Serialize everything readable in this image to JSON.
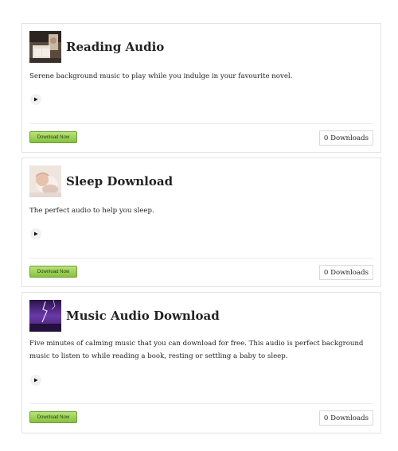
{
  "downloads": [
    {
      "title": "Reading Audio",
      "description": "Serene background music to play while you indulge in your favourite novel.",
      "button_label": "Download Now",
      "count_label": "0 Downloads",
      "thumbnail": "reading-photo-thumbnail"
    },
    {
      "title": "Sleep Download",
      "description": "The perfect audio to help you sleep.",
      "button_label": "Download Now",
      "count_label": "0 Downloads",
      "thumbnail": "sleeping-baby-thumbnail"
    },
    {
      "title": "Music Audio Download",
      "description": "Five minutes of calming music that you can download for free. This audio is perfect background music to listen to while reading a book, resting or settling a baby to sleep.",
      "button_label": "Download Now",
      "count_label": "0 Downloads",
      "thumbnail": "purple-lightning-thumbnail"
    }
  ],
  "colors": {
    "button_green": "#9fd15a",
    "border": "#e3e3e3"
  }
}
